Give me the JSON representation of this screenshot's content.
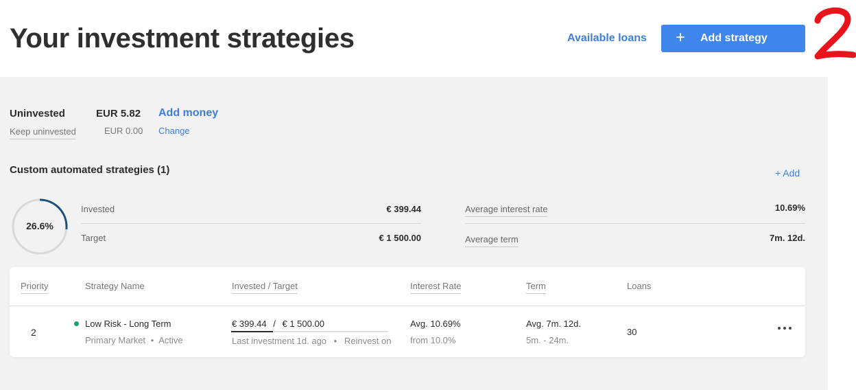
{
  "header": {
    "title": "Your investment strategies",
    "available_loans_label": "Available loans",
    "add_strategy_label": "Add strategy",
    "annotation_text": "2"
  },
  "uninvested": {
    "label": "Uninvested",
    "amount": "EUR 5.82",
    "add_money_label": "Add money",
    "keep_label": "Keep uninvested",
    "keep_amount": "EUR 0.00",
    "change_label": "Change"
  },
  "custom": {
    "title": "Custom automated strategies (1)",
    "add_label": "+ Add",
    "progress_text": "26.6%",
    "progress_fraction": 0.266,
    "invested_label": "Invested",
    "invested_value": "€ 399.44",
    "target_label": "Target",
    "target_value": "€ 1 500.00",
    "avg_rate_label": "Average interest rate",
    "avg_rate_value": "10.69%",
    "avg_term_label": "Average term",
    "avg_term_value": "7m. 12d."
  },
  "table": {
    "headers": {
      "priority": "Priority",
      "strategy_name": "Strategy Name",
      "invested_target": "Invested / Target",
      "interest_rate": "Interest Rate",
      "term": "Term",
      "loans": "Loans"
    },
    "rows": [
      {
        "priority": "2",
        "name": "Low Risk - Long Term",
        "market": "Primary Market",
        "status": "Active",
        "invested": "€ 399.44",
        "separator": "/",
        "target": "€ 1 500.00",
        "invested_fraction": 0.266,
        "last_investment": "Last investment 1d. ago",
        "reinvest": "Reinvest on",
        "rate": "Avg. 10.69%",
        "rate_sub": "from 10.0%",
        "term": "Avg. 7m. 12d.",
        "term_sub": "5m. - 24m.",
        "loans": "30"
      }
    ]
  },
  "colors": {
    "accent": "#3f86ec",
    "link": "#3d7ee0",
    "status_active": "#1f9e6e",
    "progress_ring": "#1e4f7a",
    "annotation": "#e8131b"
  }
}
